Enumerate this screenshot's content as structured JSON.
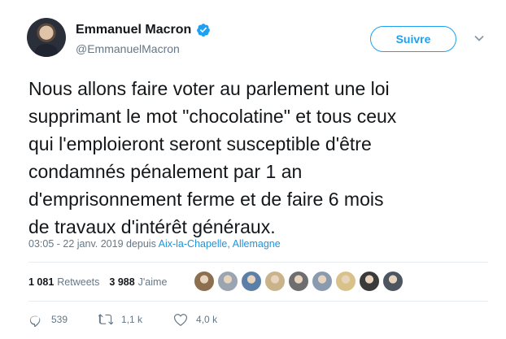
{
  "author": {
    "name": "Emmanuel Macron",
    "handle": "@EmmanuelMacron",
    "verified_color": "#1da1f2"
  },
  "follow_button": {
    "label": "Suivre"
  },
  "tweet": {
    "text": "Nous allons faire voter au parlement une loi\nsupprimant le mot \"chocolatine\" et tous ceux\nqui l'emploieront seront susceptible d'être\ncondamnés pénalement par 1 an\nd'emprisonnement ferme et de faire 6 mois\nde travaux d'intérêt généraux.",
    "time": "03:05 - 22 janv. 2019 depuis ",
    "location": "Aix-la-Chapelle, Allemagne"
  },
  "stats": {
    "retweets_count": "1 081",
    "retweets_label": "Retweets",
    "likes_count": "3 988",
    "likes_label": "J'aime"
  },
  "likers": [
    {
      "color": "#8b6f4e"
    },
    {
      "color": "#9aa5b1"
    },
    {
      "color": "#5b7fa6"
    },
    {
      "color": "#c9b38a"
    },
    {
      "color": "#6e6e6e"
    },
    {
      "color": "#8a9bb0"
    },
    {
      "color": "#d9c28a"
    },
    {
      "color": "#3a3a3a"
    },
    {
      "color": "#4d5561"
    }
  ],
  "actions": {
    "replies": "539",
    "retweets": "1,1 k",
    "likes": "4,0 k"
  },
  "colors": {
    "accent": "#1da1f2",
    "link": "#1b95e0",
    "secondary_text": "#657786"
  }
}
